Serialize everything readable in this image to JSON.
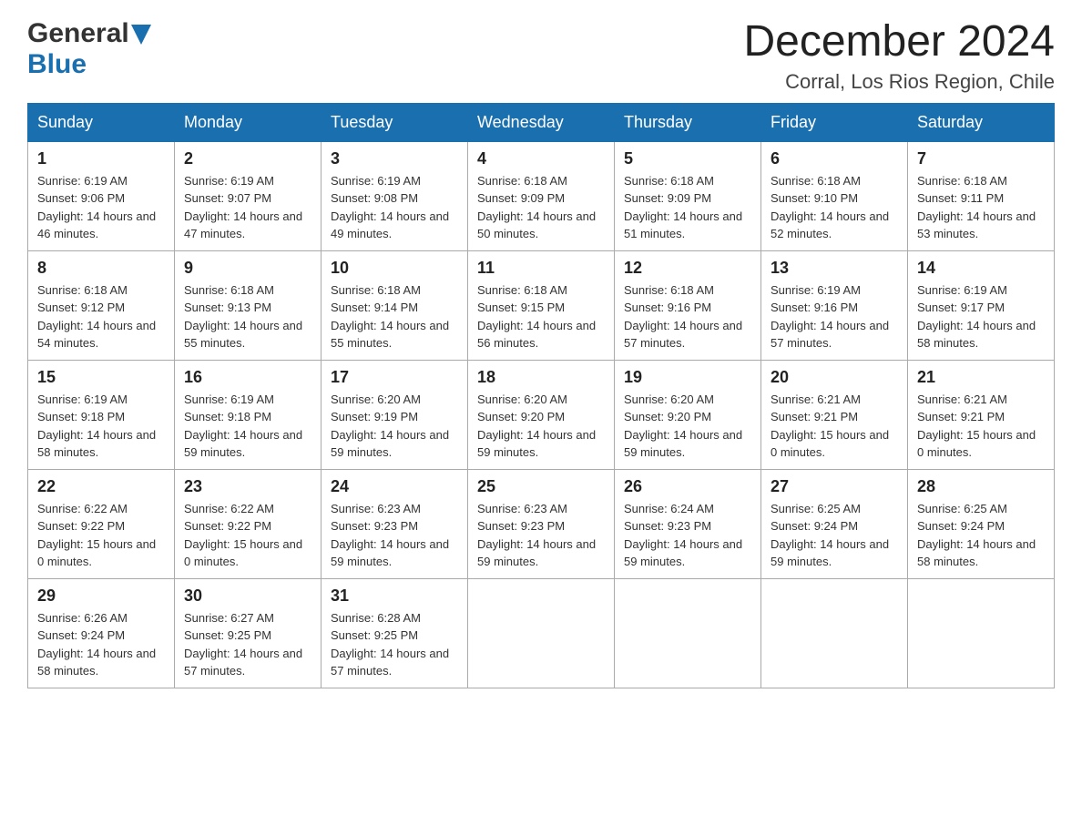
{
  "logo": {
    "general": "General",
    "blue": "Blue"
  },
  "header": {
    "month": "December 2024",
    "location": "Corral, Los Rios Region, Chile"
  },
  "weekdays": [
    "Sunday",
    "Monday",
    "Tuesday",
    "Wednesday",
    "Thursday",
    "Friday",
    "Saturday"
  ],
  "weeks": [
    [
      {
        "day": "1",
        "sunrise": "Sunrise: 6:19 AM",
        "sunset": "Sunset: 9:06 PM",
        "daylight": "Daylight: 14 hours and 46 minutes."
      },
      {
        "day": "2",
        "sunrise": "Sunrise: 6:19 AM",
        "sunset": "Sunset: 9:07 PM",
        "daylight": "Daylight: 14 hours and 47 minutes."
      },
      {
        "day": "3",
        "sunrise": "Sunrise: 6:19 AM",
        "sunset": "Sunset: 9:08 PM",
        "daylight": "Daylight: 14 hours and 49 minutes."
      },
      {
        "day": "4",
        "sunrise": "Sunrise: 6:18 AM",
        "sunset": "Sunset: 9:09 PM",
        "daylight": "Daylight: 14 hours and 50 minutes."
      },
      {
        "day": "5",
        "sunrise": "Sunrise: 6:18 AM",
        "sunset": "Sunset: 9:09 PM",
        "daylight": "Daylight: 14 hours and 51 minutes."
      },
      {
        "day": "6",
        "sunrise": "Sunrise: 6:18 AM",
        "sunset": "Sunset: 9:10 PM",
        "daylight": "Daylight: 14 hours and 52 minutes."
      },
      {
        "day": "7",
        "sunrise": "Sunrise: 6:18 AM",
        "sunset": "Sunset: 9:11 PM",
        "daylight": "Daylight: 14 hours and 53 minutes."
      }
    ],
    [
      {
        "day": "8",
        "sunrise": "Sunrise: 6:18 AM",
        "sunset": "Sunset: 9:12 PM",
        "daylight": "Daylight: 14 hours and 54 minutes."
      },
      {
        "day": "9",
        "sunrise": "Sunrise: 6:18 AM",
        "sunset": "Sunset: 9:13 PM",
        "daylight": "Daylight: 14 hours and 55 minutes."
      },
      {
        "day": "10",
        "sunrise": "Sunrise: 6:18 AM",
        "sunset": "Sunset: 9:14 PM",
        "daylight": "Daylight: 14 hours and 55 minutes."
      },
      {
        "day": "11",
        "sunrise": "Sunrise: 6:18 AM",
        "sunset": "Sunset: 9:15 PM",
        "daylight": "Daylight: 14 hours and 56 minutes."
      },
      {
        "day": "12",
        "sunrise": "Sunrise: 6:18 AM",
        "sunset": "Sunset: 9:16 PM",
        "daylight": "Daylight: 14 hours and 57 minutes."
      },
      {
        "day": "13",
        "sunrise": "Sunrise: 6:19 AM",
        "sunset": "Sunset: 9:16 PM",
        "daylight": "Daylight: 14 hours and 57 minutes."
      },
      {
        "day": "14",
        "sunrise": "Sunrise: 6:19 AM",
        "sunset": "Sunset: 9:17 PM",
        "daylight": "Daylight: 14 hours and 58 minutes."
      }
    ],
    [
      {
        "day": "15",
        "sunrise": "Sunrise: 6:19 AM",
        "sunset": "Sunset: 9:18 PM",
        "daylight": "Daylight: 14 hours and 58 minutes."
      },
      {
        "day": "16",
        "sunrise": "Sunrise: 6:19 AM",
        "sunset": "Sunset: 9:18 PM",
        "daylight": "Daylight: 14 hours and 59 minutes."
      },
      {
        "day": "17",
        "sunrise": "Sunrise: 6:20 AM",
        "sunset": "Sunset: 9:19 PM",
        "daylight": "Daylight: 14 hours and 59 minutes."
      },
      {
        "day": "18",
        "sunrise": "Sunrise: 6:20 AM",
        "sunset": "Sunset: 9:20 PM",
        "daylight": "Daylight: 14 hours and 59 minutes."
      },
      {
        "day": "19",
        "sunrise": "Sunrise: 6:20 AM",
        "sunset": "Sunset: 9:20 PM",
        "daylight": "Daylight: 14 hours and 59 minutes."
      },
      {
        "day": "20",
        "sunrise": "Sunrise: 6:21 AM",
        "sunset": "Sunset: 9:21 PM",
        "daylight": "Daylight: 15 hours and 0 minutes."
      },
      {
        "day": "21",
        "sunrise": "Sunrise: 6:21 AM",
        "sunset": "Sunset: 9:21 PM",
        "daylight": "Daylight: 15 hours and 0 minutes."
      }
    ],
    [
      {
        "day": "22",
        "sunrise": "Sunrise: 6:22 AM",
        "sunset": "Sunset: 9:22 PM",
        "daylight": "Daylight: 15 hours and 0 minutes."
      },
      {
        "day": "23",
        "sunrise": "Sunrise: 6:22 AM",
        "sunset": "Sunset: 9:22 PM",
        "daylight": "Daylight: 15 hours and 0 minutes."
      },
      {
        "day": "24",
        "sunrise": "Sunrise: 6:23 AM",
        "sunset": "Sunset: 9:23 PM",
        "daylight": "Daylight: 14 hours and 59 minutes."
      },
      {
        "day": "25",
        "sunrise": "Sunrise: 6:23 AM",
        "sunset": "Sunset: 9:23 PM",
        "daylight": "Daylight: 14 hours and 59 minutes."
      },
      {
        "day": "26",
        "sunrise": "Sunrise: 6:24 AM",
        "sunset": "Sunset: 9:23 PM",
        "daylight": "Daylight: 14 hours and 59 minutes."
      },
      {
        "day": "27",
        "sunrise": "Sunrise: 6:25 AM",
        "sunset": "Sunset: 9:24 PM",
        "daylight": "Daylight: 14 hours and 59 minutes."
      },
      {
        "day": "28",
        "sunrise": "Sunrise: 6:25 AM",
        "sunset": "Sunset: 9:24 PM",
        "daylight": "Daylight: 14 hours and 58 minutes."
      }
    ],
    [
      {
        "day": "29",
        "sunrise": "Sunrise: 6:26 AM",
        "sunset": "Sunset: 9:24 PM",
        "daylight": "Daylight: 14 hours and 58 minutes."
      },
      {
        "day": "30",
        "sunrise": "Sunrise: 6:27 AM",
        "sunset": "Sunset: 9:25 PM",
        "daylight": "Daylight: 14 hours and 57 minutes."
      },
      {
        "day": "31",
        "sunrise": "Sunrise: 6:28 AM",
        "sunset": "Sunset: 9:25 PM",
        "daylight": "Daylight: 14 hours and 57 minutes."
      },
      null,
      null,
      null,
      null
    ]
  ]
}
